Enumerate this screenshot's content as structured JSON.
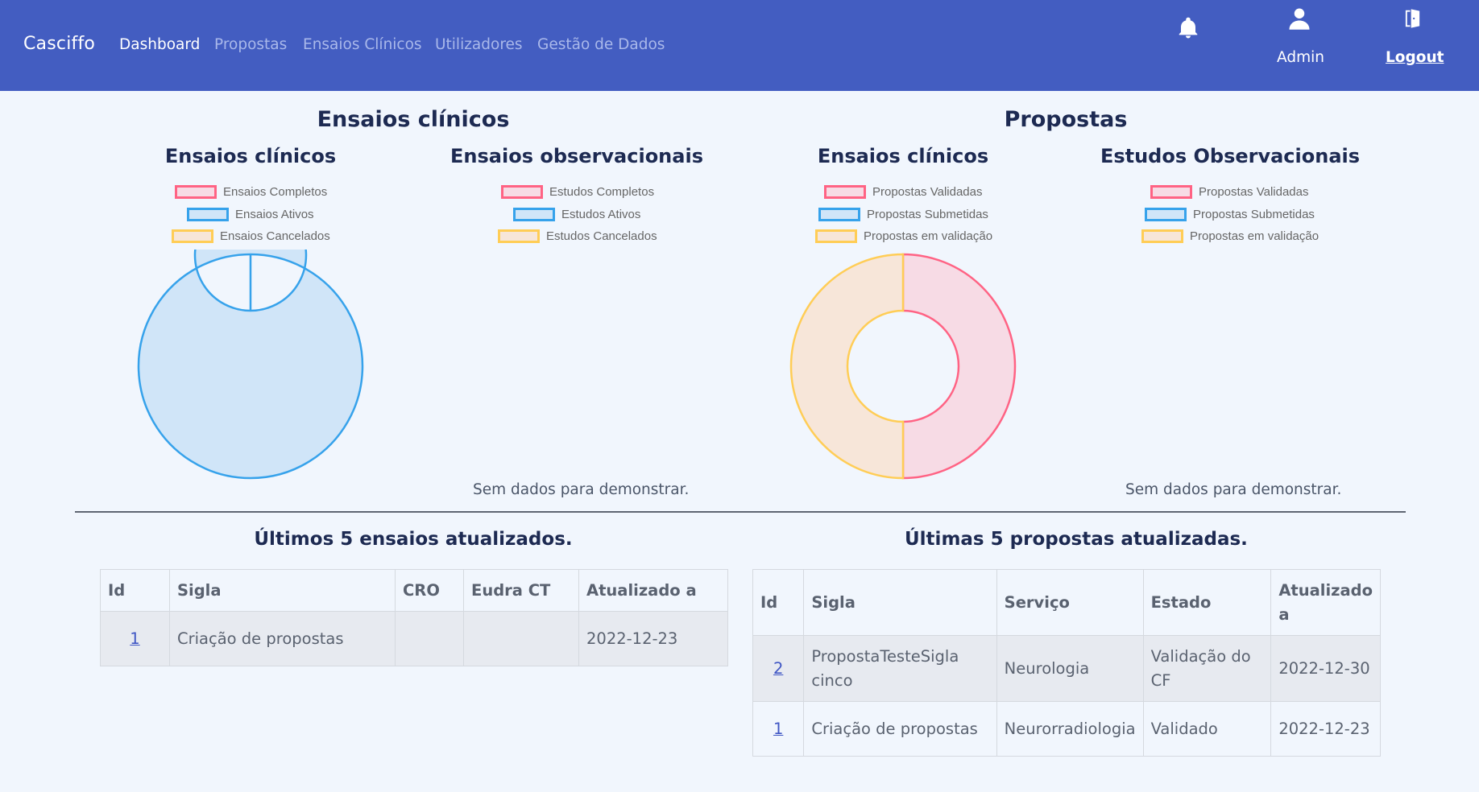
{
  "navbar": {
    "brand": "Casciffo",
    "links": [
      "Dashboard",
      "Propostas",
      "Ensaios Clínicos",
      "Utilizadores",
      "Gestão de Dados"
    ],
    "user_label": "Admin",
    "logout_label": "Logout",
    "icons": [
      "bell-icon",
      "user-icon",
      "door-exit-icon"
    ]
  },
  "sections": {
    "ensaios_title": "Ensaios clínicos",
    "propostas_title": "Propostas"
  },
  "charts": {
    "ensaios_clinicos": {
      "title": "Ensaios clínicos",
      "legend": [
        "Ensaios Completos",
        "Ensaios Ativos",
        "Ensaios Cancelados"
      ]
    },
    "ensaios_observacionais": {
      "title": "Ensaios observacionais",
      "legend": [
        "Estudos Completos",
        "Estudos Ativos",
        "Estudos Cancelados"
      ],
      "empty": "Sem dados para demonstrar."
    },
    "propostas_clinicos": {
      "title": "Ensaios clínicos",
      "legend": [
        "Propostas Validadas",
        "Propostas Submetidas",
        "Propostas em validação"
      ]
    },
    "propostas_observacionais": {
      "title": "Estudos Observacionais",
      "legend": [
        "Propostas Validadas",
        "Propostas Submetidas",
        "Propostas em validação"
      ],
      "empty": "Sem dados para demonstrar."
    }
  },
  "chart_data": [
    {
      "type": "pie",
      "title": "Ensaios clínicos",
      "categories": [
        "Ensaios Completos",
        "Ensaios Ativos",
        "Ensaios Cancelados"
      ],
      "values": [
        0,
        1,
        0
      ]
    },
    {
      "type": "pie",
      "title": "Ensaios observacionais",
      "categories": [
        "Estudos Completos",
        "Estudos Ativos",
        "Estudos Cancelados"
      ],
      "values": []
    },
    {
      "type": "pie",
      "title": "Ensaios clínicos",
      "categories": [
        "Propostas Validadas",
        "Propostas Submetidas",
        "Propostas em validação"
      ],
      "values": [
        1,
        0,
        1
      ]
    },
    {
      "type": "pie",
      "title": "Estudos Observacionais",
      "categories": [
        "Propostas Validadas",
        "Propostas Submetidas",
        "Propostas em validação"
      ],
      "values": []
    }
  ],
  "colors": {
    "red": "#ff6384",
    "red_fill": "#f7dbe5",
    "blue": "#36a2eb",
    "blue_fill": "#d0e5f8",
    "yellow": "#ffcd56",
    "yellow_fill": "#f7e6d9",
    "navbar": "#435dc1"
  },
  "ensaios_table": {
    "title": "Últimos 5 ensaios atualizados.",
    "headers": [
      "Id",
      "Sigla",
      "CRO",
      "Eudra CT",
      "Atualizado a"
    ],
    "rows": [
      [
        "1",
        "Criação de propostas",
        "",
        "",
        "2022-12-23"
      ]
    ]
  },
  "propostas_table": {
    "title": "Últimas 5 propostas atualizadas.",
    "headers": [
      "Id",
      "Sigla",
      "Serviço",
      "Estado",
      "Atualizado a"
    ],
    "rows": [
      [
        "2",
        "PropostaTesteSigla cinco",
        "Neurologia",
        "Validação do CF",
        "2022-12-30"
      ],
      [
        "1",
        "Criação de propostas",
        "Neurorradiologia",
        "Validado",
        "2022-12-23"
      ]
    ]
  }
}
